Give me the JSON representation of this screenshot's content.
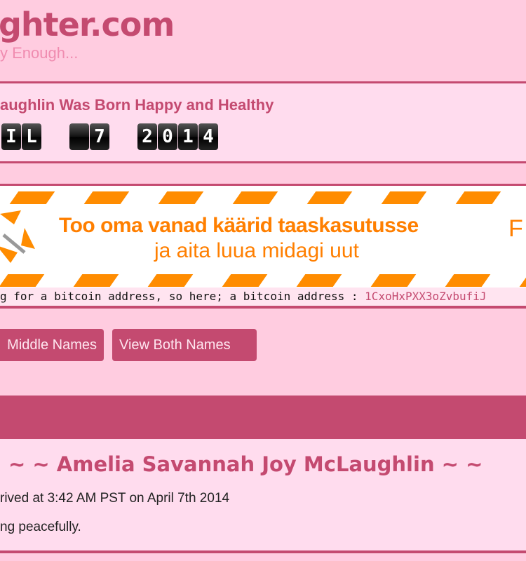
{
  "header": {
    "site_title": "ghter.com",
    "tagline": "y Enough..."
  },
  "birth": {
    "title": "aughlin Was Born Happy and Healthy",
    "month_tiles": [
      "I",
      "L"
    ],
    "day_tiles": [
      "",
      "7"
    ],
    "year_tiles": [
      "2",
      "0",
      "1",
      "4"
    ]
  },
  "ad": {
    "line1": "Too oma vanad käärid taaskasutusse",
    "line2": "ja aita luua midagi uut",
    "partial": "F"
  },
  "bitcoin": {
    "text": "g for a bitcoin address, so here; a bitcoin address : ",
    "address": "1CxoHxPXX3oZvbufiJ"
  },
  "buttons": {
    "middle_names": "Middle Names",
    "both_names": "View Both Names"
  },
  "announcement": {
    "name": "~ ~ Amelia Savannah Joy McLaughlin ~ ~",
    "arrival": "rived at 3:42 AM PST on April 7th 2014",
    "status": "ng peacefully."
  },
  "colors": {
    "accent": "#c44a70",
    "background": "#ffcce0",
    "panel": "#ffdcee",
    "ad_orange": "#ff8c00"
  }
}
